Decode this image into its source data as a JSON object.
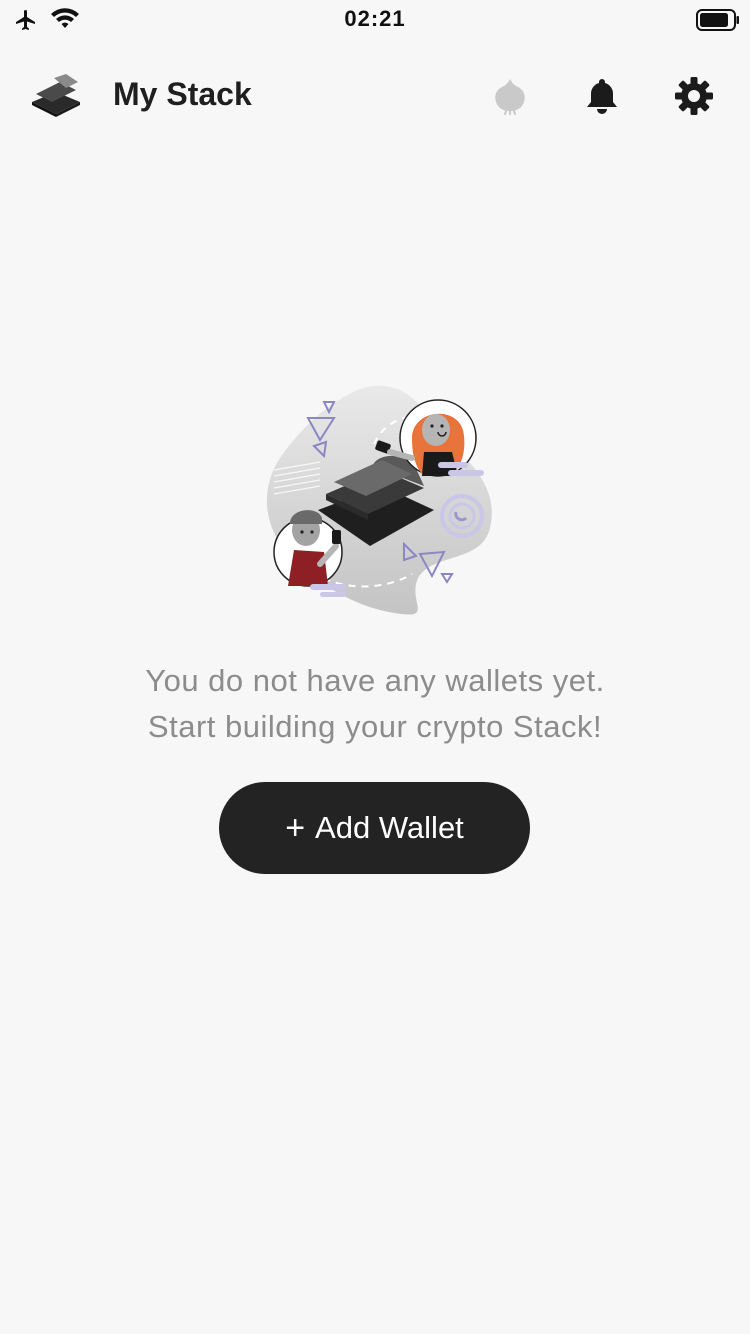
{
  "status_bar": {
    "time": "02:21",
    "icons": [
      "airplane-icon",
      "wifi-icon",
      "battery-icon"
    ]
  },
  "header": {
    "title": "My Stack",
    "icons": [
      "stack-logo-icon",
      "garlic-icon",
      "bell-icon",
      "gear-icon"
    ]
  },
  "empty_state": {
    "line1": "You do not have any wallets yet.",
    "line2": "Start building your crypto Stack!",
    "illustration": "wallet-exchange-illustration"
  },
  "actions": {
    "add_wallet_plus": "+",
    "add_wallet_label": "Add Wallet"
  },
  "colors": {
    "background": "#f7f7f7",
    "button": "#232323",
    "button_text": "#ffffff",
    "muted_text": "#8c8c8c",
    "accent_orange": "#e8743b",
    "accent_lavender": "#c9c6e8"
  }
}
